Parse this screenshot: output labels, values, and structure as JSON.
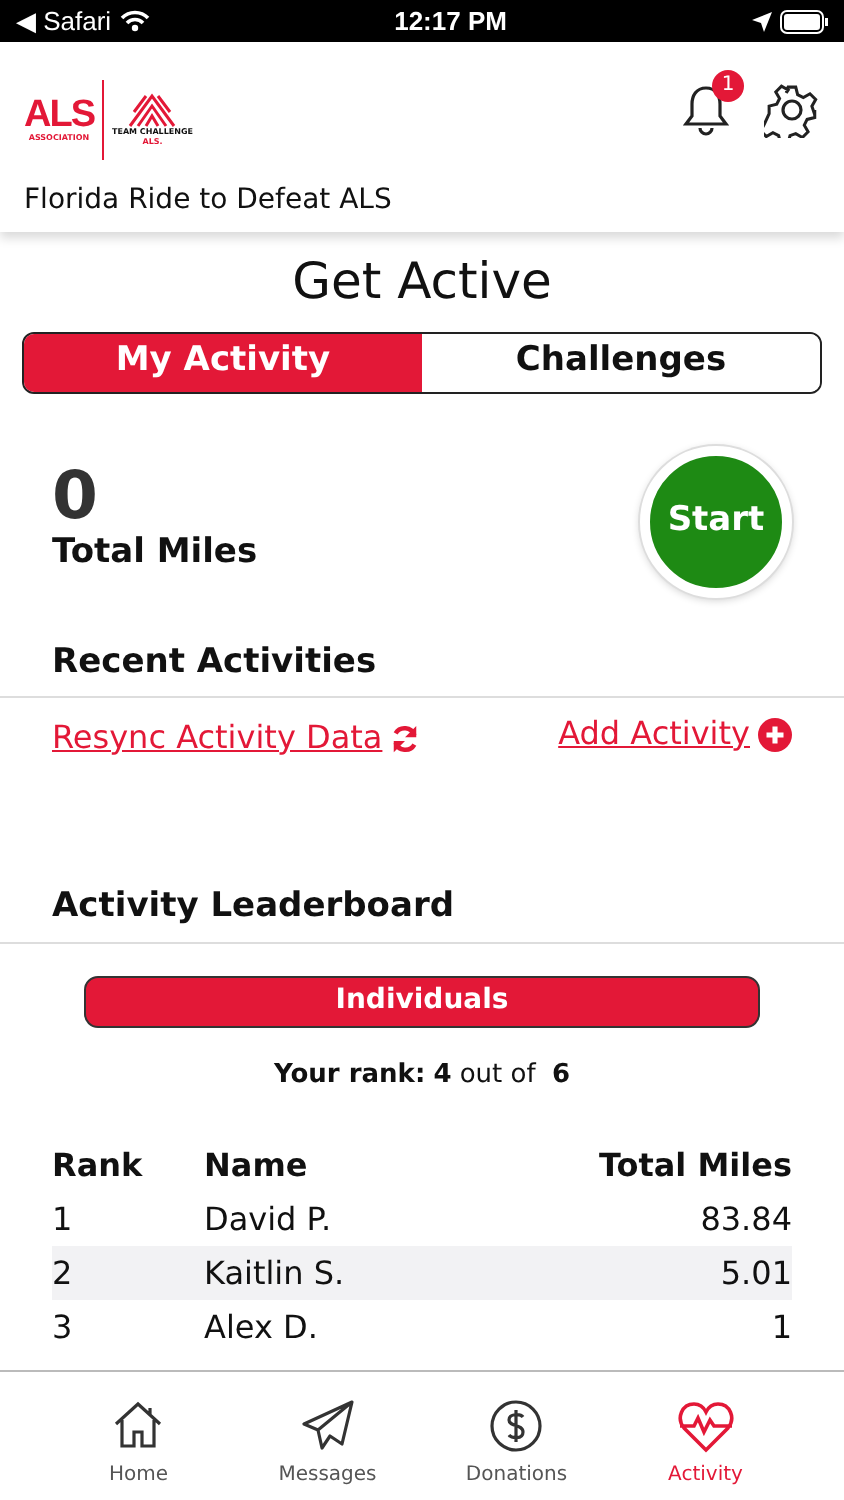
{
  "status_bar": {
    "back_app": "◀ Safari",
    "time": "12:17 PM"
  },
  "header": {
    "logo": {
      "main": "ALS",
      "sub": "ASSOCIATION",
      "team": "TEAM CHALLENGE",
      "team_mark": "ALS."
    },
    "notification_count": "1",
    "event_name": "Florida Ride to Defeat ALS"
  },
  "page_title": "Get Active",
  "segments": [
    {
      "label": "My Activity",
      "selected": true
    },
    {
      "label": "Challenges",
      "selected": false
    }
  ],
  "total": {
    "value": "0",
    "label": "Total Miles"
  },
  "start_button": "Start",
  "recent": {
    "title": "Recent Activities",
    "resync_link": "Resync Activity Data",
    "add_link": "Add Activity "
  },
  "leaderboard": {
    "title": "Activity Leaderboard",
    "filter_button": "Individuals",
    "rank_label": "Your rank:",
    "rank": "4",
    "out_of": "out of",
    "total": "6",
    "columns": [
      "Rank",
      "Name",
      "Total Miles"
    ],
    "rows": [
      [
        "1",
        "David P.",
        "83.84"
      ],
      [
        "2",
        "Kaitlin S.",
        "5.01"
      ],
      [
        "3",
        "Alex D.",
        "1"
      ]
    ]
  },
  "tab_bar": [
    {
      "label": "Home",
      "selected": false
    },
    {
      "label": "Messages",
      "selected": false
    },
    {
      "label": "Donations",
      "selected": false
    },
    {
      "label": "Activity",
      "selected": true
    }
  ]
}
